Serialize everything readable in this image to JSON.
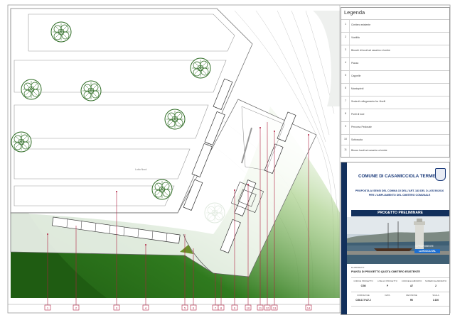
{
  "legend": {
    "title": "Legenda",
    "items": [
      {
        "num": "1",
        "text": "Cimitero esistente"
      },
      {
        "num": "2",
        "text": "Viabilità"
      },
      {
        "num": "3",
        "text": "Blocchi di loculi ad ossarino e tombe"
      },
      {
        "num": "4",
        "text": "Piazza"
      },
      {
        "num": "5",
        "text": "Cappelle"
      },
      {
        "num": "6",
        "text": "Marciapiedi"
      },
      {
        "num": "7",
        "text": "Scala di collegamento fra i livelli"
      },
      {
        "num": "8",
        "text": "Punti di luce"
      },
      {
        "num": "9",
        "text": "Percorso Pedonale"
      },
      {
        "num": "10",
        "text": "Sottoscala"
      },
      {
        "num": "11",
        "text": "Blocco loculi ad ossarino a tombe"
      }
    ]
  },
  "titleblock": {
    "comune": "COMUNE DI CASAMICCIOLA TERME",
    "subtitle_1": "PROPOSTA AI SENSI DEL COMMA 15 DELL'ART. 183 DEL D.LGS 50/2016",
    "subtitle_2": "PER L'AMPLIAMENTO DEL CIMITERO COMUNALE",
    "fase": "PROGETTO PRELIMINARE",
    "proponente_label": "IL PROPONENTE",
    "proponente": "LA ROCCA SRL",
    "tavola_label": "ELABORATO:",
    "tavola": "PIANTA DI PROGETTO QUOTA CIMITERO ESISTENTE",
    "fields": [
      {
        "label": "CODICE PROGETTO",
        "value": "C/08"
      },
      {
        "label": "LIVELLO PROGETTO",
        "value": "P"
      },
      {
        "label": "CODICE ELABORATO",
        "value": "A7"
      },
      {
        "label": "NUMERO ELABORATO",
        "value": "2"
      }
    ],
    "fields_2": [
      {
        "label": "CODICE FILE",
        "value": "C/08.17.P.A7.2"
      },
      {
        "label": "DATA",
        "value": ""
      },
      {
        "label": "REVISIONE",
        "value": "R0"
      },
      {
        "label": "SCALA",
        "value": "1:100"
      }
    ]
  },
  "plan": {
    "area_label": "Lotto Nord",
    "callouts": [
      "1",
      "2",
      "3",
      "4",
      "5",
      "6",
      "7",
      "8",
      "9",
      "10",
      "11",
      "12",
      "13",
      "14",
      "15"
    ]
  },
  "colors": {
    "green_dark": "#1f5c12",
    "navy": "#12305c",
    "callout_red": "#b02040"
  }
}
